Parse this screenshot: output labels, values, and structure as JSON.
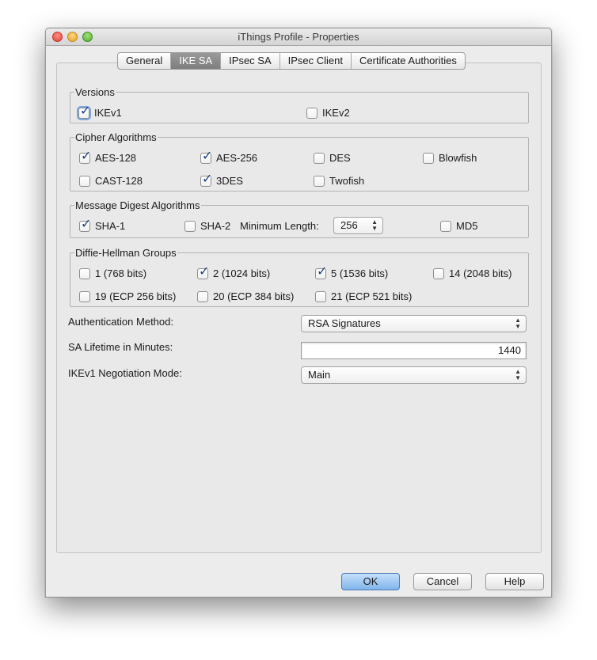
{
  "window": {
    "title": "iThings Profile - Properties"
  },
  "tabs": [
    {
      "label": "General",
      "active": false
    },
    {
      "label": "IKE SA",
      "active": true
    },
    {
      "label": "IPsec SA",
      "active": false
    },
    {
      "label": "IPsec Client",
      "active": false
    },
    {
      "label": "Certificate Authorities",
      "active": false
    }
  ],
  "versions": {
    "legend": "Versions",
    "ikev1": {
      "label": "IKEv1",
      "checked": true
    },
    "ikev2": {
      "label": "IKEv2",
      "checked": false
    }
  },
  "cipher": {
    "legend": "Cipher Algorithms",
    "aes128": {
      "label": "AES-128",
      "checked": true
    },
    "aes256": {
      "label": "AES-256",
      "checked": true
    },
    "des": {
      "label": "DES",
      "checked": false
    },
    "blowfish": {
      "label": "Blowfish",
      "checked": false
    },
    "cast128": {
      "label": "CAST-128",
      "checked": false
    },
    "tdes": {
      "label": "3DES",
      "checked": true
    },
    "twofish": {
      "label": "Twofish",
      "checked": false
    }
  },
  "digest": {
    "legend": "Message Digest Algorithms",
    "sha1": {
      "label": "SHA-1",
      "checked": true
    },
    "sha2": {
      "label": "SHA-2",
      "checked": false
    },
    "min_length_label": "Minimum Length:",
    "min_length_value": "256",
    "md5": {
      "label": "MD5",
      "checked": false
    }
  },
  "dh": {
    "legend": "Diffie-Hellman Groups",
    "g1": {
      "label": "1  (768 bits)",
      "checked": false
    },
    "g2": {
      "label": "2  (1024 bits)",
      "checked": true
    },
    "g5": {
      "label": "5  (1536 bits)",
      "checked": true
    },
    "g14": {
      "label": "14 (2048 bits)",
      "checked": false
    },
    "g19": {
      "label": "19 (ECP 256 bits)",
      "checked": false
    },
    "g20": {
      "label": "20 (ECP 384 bits)",
      "checked": false
    },
    "g21": {
      "label": "21 (ECP 521 bits)",
      "checked": false
    }
  },
  "auth": {
    "label": "Authentication Method:",
    "value": "RSA Signatures"
  },
  "lifetime": {
    "label": "SA Lifetime in Minutes:",
    "value": "1440"
  },
  "negotiation": {
    "label": "IKEv1 Negotiation Mode:",
    "value": "Main"
  },
  "buttons": {
    "ok": "OK",
    "cancel": "Cancel",
    "help": "Help"
  },
  "icons": {
    "checkmark": "check-icon",
    "stepper": "stepper-arrows-icon"
  }
}
